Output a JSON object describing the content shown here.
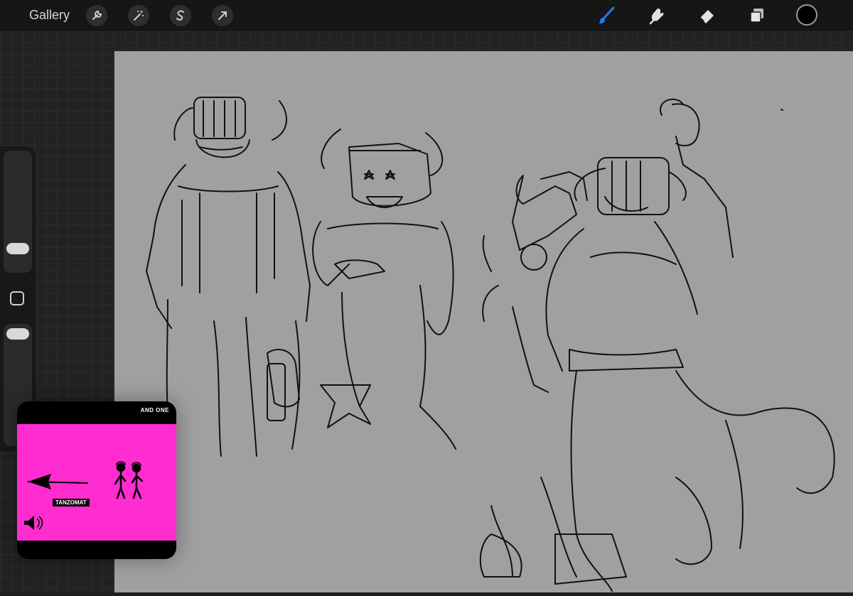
{
  "topbar": {
    "gallery_label": "Gallery",
    "left_tools": [
      "wrench-icon",
      "magic-wand-icon",
      "selection-s-icon",
      "transform-arrow-icon"
    ],
    "right_tools": [
      "brush-icon",
      "smudge-icon",
      "eraser-icon",
      "layers-icon"
    ],
    "active_tool": "brush-icon",
    "accent_color": "#1e7cf2",
    "current_color": "#000000"
  },
  "sidebar": {
    "brush_size_level": 0.75,
    "opacity_level": 0.05
  },
  "canvas": {
    "background": "#a0a0a0",
    "content": "pencil sketch of four cartoon characters with horns"
  },
  "music_overlay": {
    "artist": "AND ONE",
    "title": "TANZOMAT",
    "background": "#ff2ccf",
    "icon": "speaker-icon"
  }
}
